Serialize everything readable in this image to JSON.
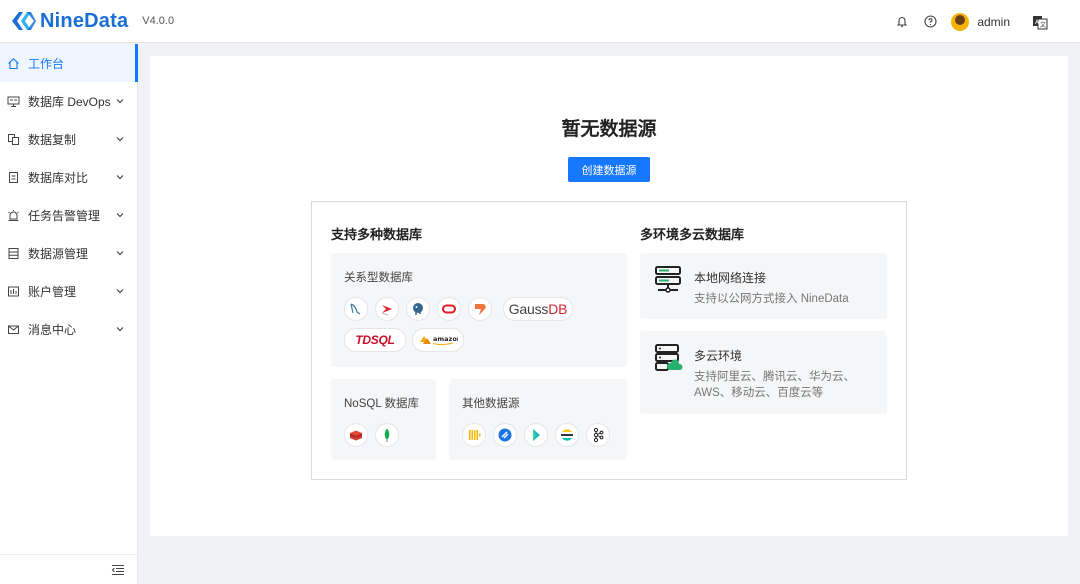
{
  "header": {
    "brand": "NineData",
    "version": "V4.0.0",
    "username": "admin",
    "icons": [
      "bell-icon",
      "help-icon",
      "avatar",
      "language-icon"
    ]
  },
  "sidebar": {
    "items": [
      {
        "label": "工作台",
        "icon": "home-icon",
        "active": true
      },
      {
        "label": "数据库 DevOps",
        "icon": "monitor-icon"
      },
      {
        "label": "数据复制",
        "icon": "copy-icon"
      },
      {
        "label": "数据库对比",
        "icon": "compare-icon"
      },
      {
        "label": "任务告警管理",
        "icon": "alarm-icon"
      },
      {
        "label": "数据源管理",
        "icon": "datasource-icon"
      },
      {
        "label": "账户管理",
        "icon": "account-icon"
      },
      {
        "label": "消息中心",
        "icon": "mail-icon"
      }
    ]
  },
  "main": {
    "empty_title": "暂无数据源",
    "create_button": "创建数据源",
    "support_title": "支持多种数据库",
    "cloud_title": "多环境多云数据库",
    "relational": {
      "label": "关系型数据库",
      "icons": [
        "mysql-icon",
        "sqlserver-icon",
        "postgresql-icon",
        "oracle-icon",
        "tidb-icon",
        "gaussdb-logo",
        "tdsql-logo",
        "amazon-aurora-logo"
      ],
      "gauss_text_a": "Gauss",
      "gauss_text_b": "DB",
      "tdsql_text": "TDSQL",
      "amazon_text": "amazon"
    },
    "nosql": {
      "label": "NoSQL 数据库",
      "icons": [
        "redis-icon",
        "mongodb-icon"
      ]
    },
    "other": {
      "label": "其他数据源",
      "icons": [
        "clickhouse-icon",
        "starrocks-icon",
        "doris-icon",
        "elasticsearch-icon",
        "kafka-icon"
      ]
    },
    "features": [
      {
        "title": "本地网络连接",
        "desc": "支持以公网方式接入 NineData"
      },
      {
        "title": "多云环境",
        "desc_line1": "支持阿里云、腾讯云、华为云、",
        "desc_line2": "AWS、移动云、百度云等"
      }
    ]
  },
  "colors": {
    "accent": "#1677ff",
    "brand": "#1a6fd6",
    "panel_bg": "#f5f6f7"
  }
}
